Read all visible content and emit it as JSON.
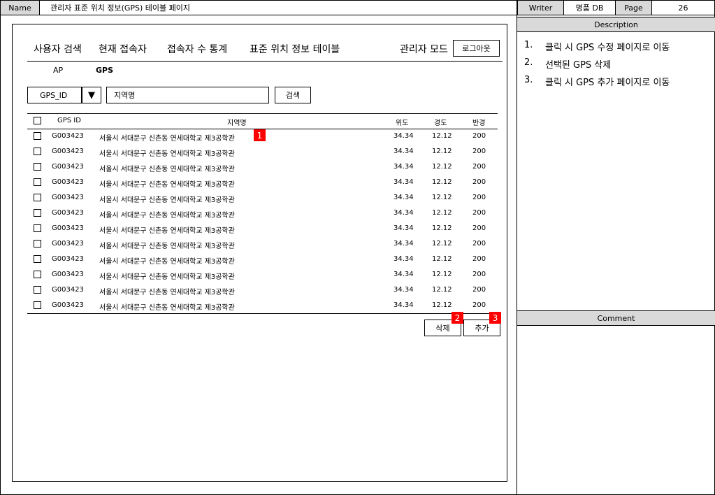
{
  "header": {
    "name_label": "Name",
    "name_value": "관리자 표준 위치 정보(GPS) 테이블 페이지",
    "writer_label": "Writer",
    "writer_value": "명품 DB",
    "page_label": "Page",
    "page_value": "26"
  },
  "right_panel": {
    "description_title": "Description",
    "descriptions": [
      {
        "num": "1.",
        "text": "클릭 시 GPS 수정 페이지로 이동"
      },
      {
        "num": "2.",
        "text": "선택된 GPS 삭제"
      },
      {
        "num": "3.",
        "text": "클릭 시 GPS 추가 페이지로 이동"
      }
    ],
    "comment_title": "Comment"
  },
  "nav": {
    "items": [
      "사용자 검색",
      "현재 접속자",
      "접속자 수 통계",
      "표준 위치 정보 테이블"
    ],
    "mode_label": "관리자 모드",
    "logout_label": "로그아웃"
  },
  "subnav": {
    "items": [
      "AP",
      "GPS"
    ],
    "active": "GPS"
  },
  "search": {
    "field_select": "GPS_ID",
    "dropdown_icon": "triangle-down-icon",
    "input_value": "지역명",
    "button_label": "검색"
  },
  "table": {
    "columns": [
      "GPS ID",
      "지역명",
      "위도",
      "경도",
      "반경"
    ],
    "rows": [
      {
        "id": "G003423",
        "name": "서울시 서대문구 신촌동 연세대학교 제3공학관",
        "lat": "34.34",
        "lng": "12.12",
        "radius": "200"
      },
      {
        "id": "G003423",
        "name": "서울시 서대문구 신촌동 연세대학교 제3공학관",
        "lat": "34.34",
        "lng": "12.12",
        "radius": "200"
      },
      {
        "id": "G003423",
        "name": "서울시 서대문구 신촌동 연세대학교 제3공학관",
        "lat": "34.34",
        "lng": "12.12",
        "radius": "200"
      },
      {
        "id": "G003423",
        "name": "서울시 서대문구 신촌동 연세대학교 제3공학관",
        "lat": "34.34",
        "lng": "12.12",
        "radius": "200"
      },
      {
        "id": "G003423",
        "name": "서울시 서대문구 신촌동 연세대학교 제3공학관",
        "lat": "34.34",
        "lng": "12.12",
        "radius": "200"
      },
      {
        "id": "G003423",
        "name": "서울시 서대문구 신촌동 연세대학교 제3공학관",
        "lat": "34.34",
        "lng": "12.12",
        "radius": "200"
      },
      {
        "id": "G003423",
        "name": "서울시 서대문구 신촌동 연세대학교 제3공학관",
        "lat": "34.34",
        "lng": "12.12",
        "radius": "200"
      },
      {
        "id": "G003423",
        "name": "서울시 서대문구 신촌동 연세대학교 제3공학관",
        "lat": "34.34",
        "lng": "12.12",
        "radius": "200"
      },
      {
        "id": "G003423",
        "name": "서울시 서대문구 신촌동 연세대학교 제3공학관",
        "lat": "34.34",
        "lng": "12.12",
        "radius": "200"
      },
      {
        "id": "G003423",
        "name": "서울시 서대문구 신촌동 연세대학교 제3공학관",
        "lat": "34.34",
        "lng": "12.12",
        "radius": "200"
      },
      {
        "id": "G003423",
        "name": "서울시 서대문구 신촌동 연세대학교 제3공학관",
        "lat": "34.34",
        "lng": "12.12",
        "radius": "200"
      },
      {
        "id": "G003423",
        "name": "서울시 서대문구 신촌동 연세대학교 제3공학관",
        "lat": "34.34",
        "lng": "12.12",
        "radius": "200"
      }
    ]
  },
  "actions": {
    "delete_label": "삭제",
    "add_label": "추가"
  },
  "markers": [
    "1",
    "2",
    "3"
  ],
  "colors": {
    "header_gray": "#d9d9d9",
    "marker_red": "#ff0000"
  }
}
